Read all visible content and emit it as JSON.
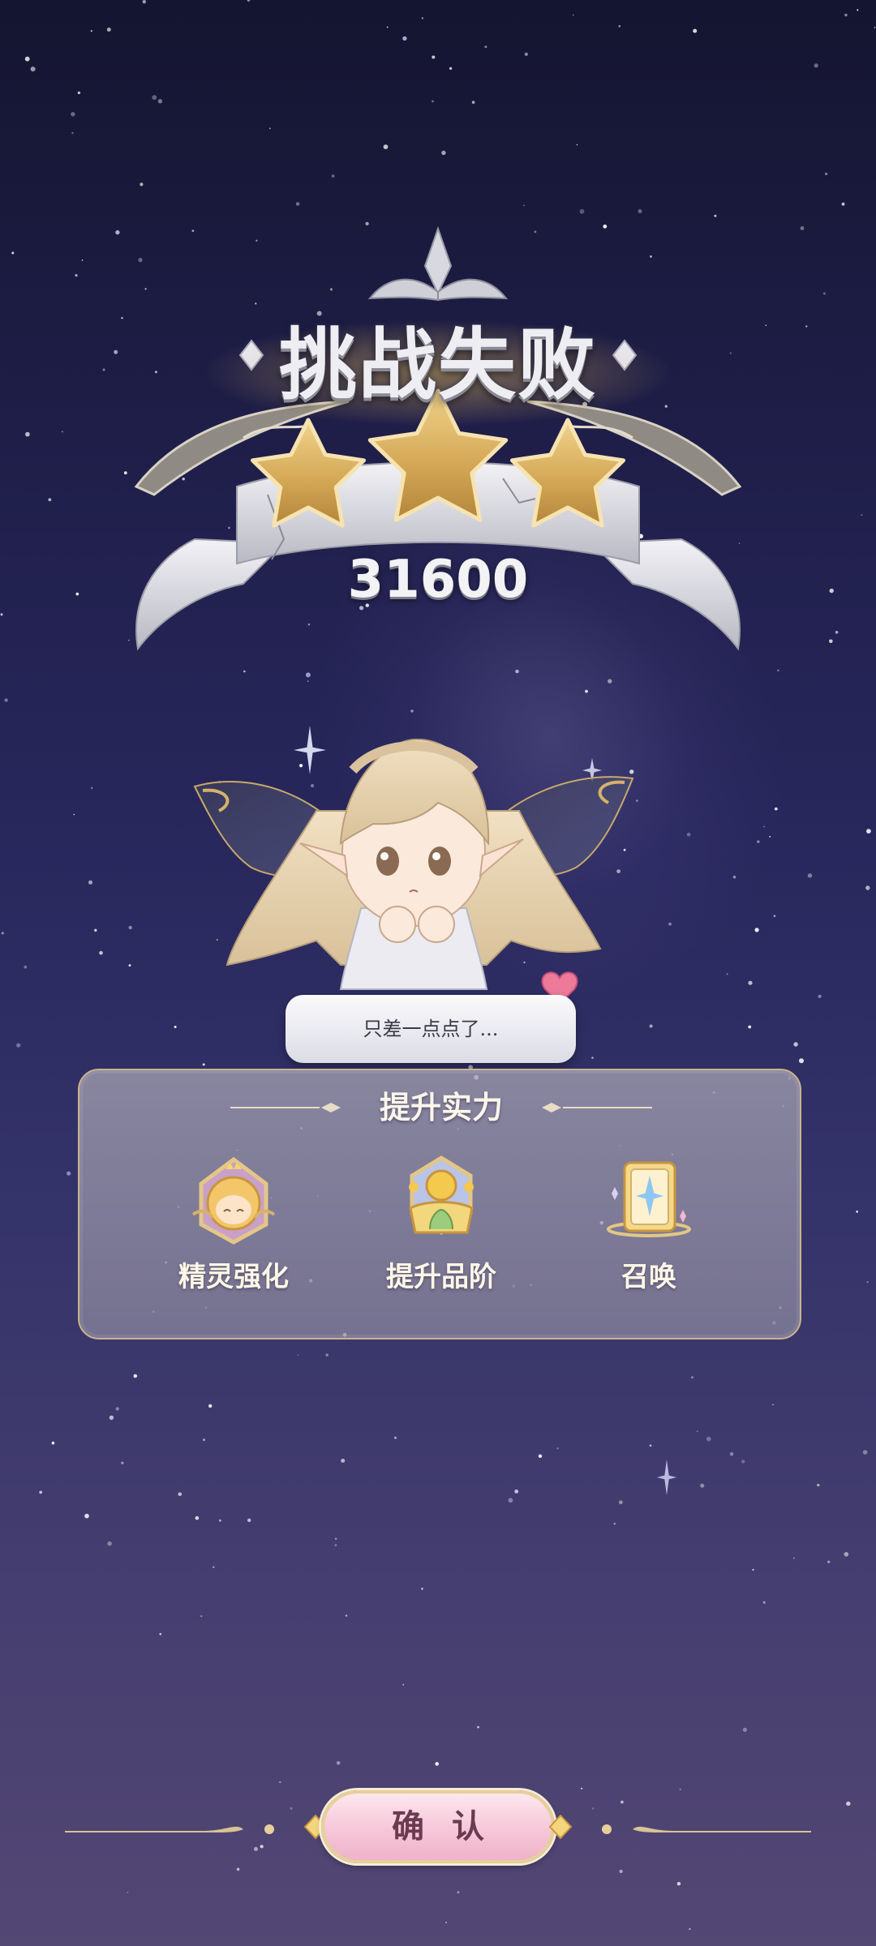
{
  "result": {
    "title": "挑战失败",
    "score": "31600",
    "stars_earned": 3,
    "stars_total": 3
  },
  "fairy": {
    "speech": "只差一点点了..."
  },
  "power_panel": {
    "title": "提升实力",
    "items": [
      {
        "label": "精灵强化",
        "icon": "fairy-enhance-icon"
      },
      {
        "label": "提升品阶",
        "icon": "rank-up-icon"
      },
      {
        "label": "召唤",
        "icon": "summon-card-icon"
      }
    ]
  },
  "footer": {
    "confirm_label": "确认"
  },
  "colors": {
    "gold": "#d9b25f",
    "silver": "#e8e8ee",
    "panel": "#9d99ae",
    "button_pink": "#f6c7d8",
    "button_text": "#6b3b4f"
  }
}
